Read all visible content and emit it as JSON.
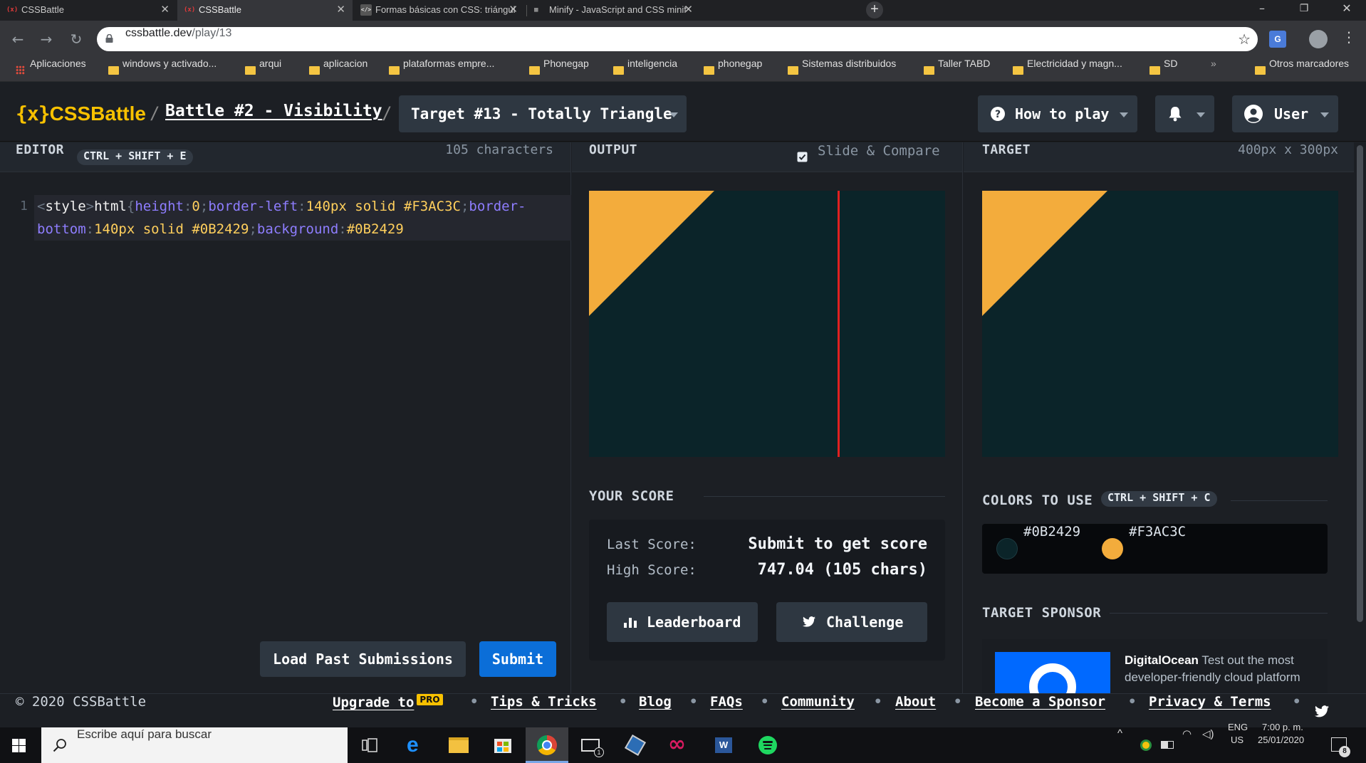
{
  "browser": {
    "tabs": [
      {
        "title": "CSSBattle",
        "favicon": "(x)"
      },
      {
        "title": "CSSBattle",
        "favicon": "(x)"
      },
      {
        "title": "Formas básicas con CSS: triángul",
        "favicon": "</>"
      },
      {
        "title": "Minify - JavaScript and CSS minif",
        "favicon": "▦"
      }
    ],
    "url_host": "cssbattle.dev",
    "url_path": "/play/13",
    "bookmarks": [
      "Aplicaciones",
      "windows y activado...",
      "arqui",
      "aplicacion",
      "plataformas empre...",
      "Phonegap",
      "inteligencia",
      "phonegap",
      "Sistemas distribuidos",
      "Taller TABD",
      "Electricidad y magn...",
      "SD"
    ],
    "bookmarks_overflow": "»",
    "other_bookmarks": "Otros marcadores"
  },
  "header": {
    "logo_mark": "{x}",
    "logo_text": "CSSBattle",
    "separator": "/",
    "battle": "Battle #2 - Visibility",
    "target": "Target #13 - Totally Triangle",
    "how_to_play": "How to play",
    "user": "User"
  },
  "editor": {
    "title": "EDITOR",
    "shortcut": "CTRL + SHIFT + E",
    "char_count": "105 characters",
    "line_number": "1",
    "code_tokens": [
      {
        "t": "<",
        "c": "punc"
      },
      {
        "t": "style",
        "c": "tag"
      },
      {
        "t": ">",
        "c": "punc"
      },
      {
        "t": "html",
        "c": "tag"
      },
      {
        "t": "{",
        "c": "punc"
      },
      {
        "t": "height",
        "c": "prop"
      },
      {
        "t": ":",
        "c": "punc"
      },
      {
        "t": "0",
        "c": "val"
      },
      {
        "t": ";",
        "c": "punc"
      },
      {
        "t": "border-left",
        "c": "prop"
      },
      {
        "t": ":",
        "c": "punc"
      },
      {
        "t": "140px solid #F3AC3C",
        "c": "val"
      },
      {
        "t": ";",
        "c": "punc"
      },
      {
        "t": "border-bottom",
        "c": "prop"
      },
      {
        "t": ":",
        "c": "punc"
      },
      {
        "t": "140px solid #0B2429",
        "c": "val"
      },
      {
        "t": ";",
        "c": "punc"
      },
      {
        "t": "background",
        "c": "prop"
      },
      {
        "t": ":",
        "c": "punc"
      },
      {
        "t": "#0B2429",
        "c": "val"
      }
    ],
    "load_button": "Load Past Submissions",
    "submit_button": "Submit"
  },
  "output": {
    "title": "OUTPUT",
    "slide_compare": "Slide & Compare",
    "slide_compare_checked": true,
    "your_score": "YOUR SCORE",
    "last_score_label": "Last Score:",
    "last_score_value": "Submit to get score",
    "high_score_label": "High Score:",
    "high_score_value": "747.04 (105 chars)",
    "leaderboard_button": "Leaderboard",
    "challenge_button": "Challenge"
  },
  "target": {
    "title": "TARGET",
    "size": "400px x 300px",
    "colors_title": "COLORS TO USE",
    "colors_shortcut": "CTRL + SHIFT + C",
    "colors": [
      "#0B2429",
      "#F3AC3C"
    ],
    "sponsor_title": "TARGET SPONSOR",
    "sponsor_name": "DigitalOcean",
    "sponsor_text": "Test out the most developer-friendly cloud platform"
  },
  "footer": {
    "copyright": "© 2020 CSSBattle",
    "links": [
      "Upgrade to",
      "Tips & Tricks",
      "Blog",
      "FAQs",
      "Community",
      "About",
      "Become a Sponsor",
      "Privacy & Terms"
    ],
    "pro_badge": "PRO",
    "dot": "•"
  },
  "taskbar": {
    "search_placeholder": "Escribe aquí para buscar",
    "language": "ENG",
    "region": "US",
    "time": "7:00 p. m.",
    "date": "25/01/2020",
    "notifications": "8"
  },
  "colors": {
    "accent": "#f8c100",
    "canvas_bg": "#0b2429",
    "triangle": "#f3ac3c",
    "submit_blue": "#0b6ed8"
  }
}
